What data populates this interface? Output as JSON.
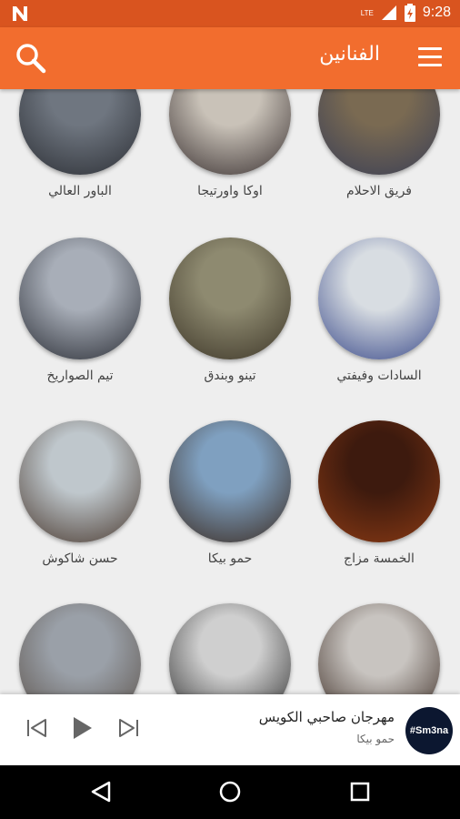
{
  "status_bar": {
    "time": "9:28",
    "network_label": "LTE"
  },
  "toolbar": {
    "title": "الفنانين"
  },
  "artists": [
    {
      "name": "فريق الاحلام",
      "colors": [
        "#7a6a52",
        "#3a3f55"
      ]
    },
    {
      "name": "اوكا واورتيجا",
      "colors": [
        "#c9c2b8",
        "#3b3232"
      ]
    },
    {
      "name": "الباور العالي",
      "colors": [
        "#6f7680",
        "#2c2f35"
      ]
    },
    {
      "name": "السادات وفيفتي",
      "colors": [
        "#d8dde2",
        "#3a4a8a"
      ]
    },
    {
      "name": "تينو وبندق",
      "colors": [
        "#8e8a70",
        "#3d3628"
      ]
    },
    {
      "name": "تيم الصواريخ",
      "colors": [
        "#a8aeb8",
        "#2b2e36"
      ]
    },
    {
      "name": "الخمسة مزاج",
      "colors": [
        "#3d1a0e",
        "#8a3a14"
      ]
    },
    {
      "name": "حمو بيكا",
      "colors": [
        "#7fa0c0",
        "#3a2a20"
      ]
    },
    {
      "name": "حسن شاكوش",
      "colors": [
        "#bfc7cc",
        "#4a3a30"
      ]
    },
    {
      "name": "",
      "colors": [
        "#9aa0a8",
        "#5a5048"
      ]
    },
    {
      "name": "",
      "colors": [
        "#cfcfcf",
        "#2a2a2a"
      ]
    },
    {
      "name": "",
      "colors": [
        "#c8c4c0",
        "#3a2a22"
      ]
    }
  ],
  "player": {
    "song_title": "مهرجان صاحبي الكويس",
    "artist": "حمو بيكا",
    "art_text": "#Sm3na"
  }
}
